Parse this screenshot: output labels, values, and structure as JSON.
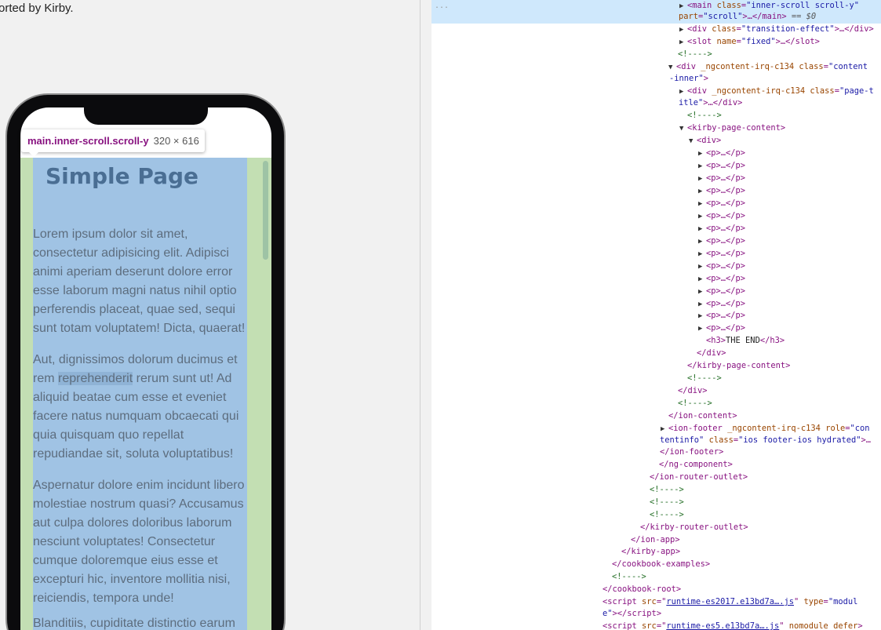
{
  "page_text": {
    "top_text": "orted by Kirby."
  },
  "phone": {
    "title": "Simple Page",
    "paragraphs": [
      "Lorem ipsum dolor sit amet, consectetur adipisicing elit. Adipisci animi aperiam deserunt dolore error esse laborum magni natus nihil optio perferendis placeat, quae sed, sequi sunt totam voluptatem! Dicta, quaerat!",
      "Aut, dignissimos dolorum ducimus et rem ",
      "reprehenderit",
      " rerum sunt ut! Ad aliquid beatae cum esse et eveniet facere natus numquam obcaecati qui quia quisquam quo repellat repudiandae sit, soluta voluptatibus!",
      "Aspernatur dolore enim incidunt libero molestiae nostrum quasi? Accusamus aut culpa dolores doloribus laborum nesciunt voluptates! Consectetur cumque doloremque eius esse et excepturi hic, inventore mollitia nisi, reiciendis, tempora unde!",
      "Blanditiis, cupiditate distinctio earum"
    ]
  },
  "tooltip": {
    "selector": "main.inner-scroll.scroll-y",
    "dimensions": "320 × 616"
  },
  "devtools": {
    "ellipsis": "...",
    "dom_tree": {
      "main_tag": "main",
      "main_class_attr": "class",
      "main_class_val": "\"inner-scroll scroll-y\"",
      "main_part_attr": "part",
      "main_part_val": "\"scroll\"",
      "main_close": ">…</main>",
      "selected_marker": " == $0",
      "div_transition_class": "\"transition-effect\"",
      "slot_name_val": "\"fixed\"",
      "comment": "<!---->",
      "ngcontent_attr": "_ngcontent-irq-c134",
      "content_inner_class_a": "\"content",
      "content_inner_class_b": "-inner\"",
      "page_title_class_a": "\"page-t",
      "page_title_class_b": "itle\"",
      "kirby_page_content": "kirby-page-content",
      "p_collapsed_count": 15,
      "p_collapsed": "<p>…</p>",
      "h3_text": "THE END",
      "ion_content": "ion-content",
      "ion_footer_role_attr": "role",
      "ion_footer_role_val_a": "\"con",
      "ion_footer_role_val_b": "tentinfo\"",
      "ion_footer_class_val": "\"ios footer-ios hydrated\"",
      "ng_component": "ng-component",
      "ion_router_outlet": "ion-router-outlet",
      "kirby_router_outlet": "kirby-router-outlet",
      "ion_app": "ion-app",
      "kirby_app": "kirby-app",
      "cookbook_examples": "cookbook-examples",
      "cookbook_root": "cookbook-root",
      "script1_src": "runtime-es2017.e13bd7a….js",
      "script1_type_val_a": "\"modul",
      "script1_type_val_b": "e\"",
      "script2_src": "runtime-es5.e13bd7a….js",
      "script2_nomodule": "nomodule",
      "script2_defer": "defer"
    }
  }
}
